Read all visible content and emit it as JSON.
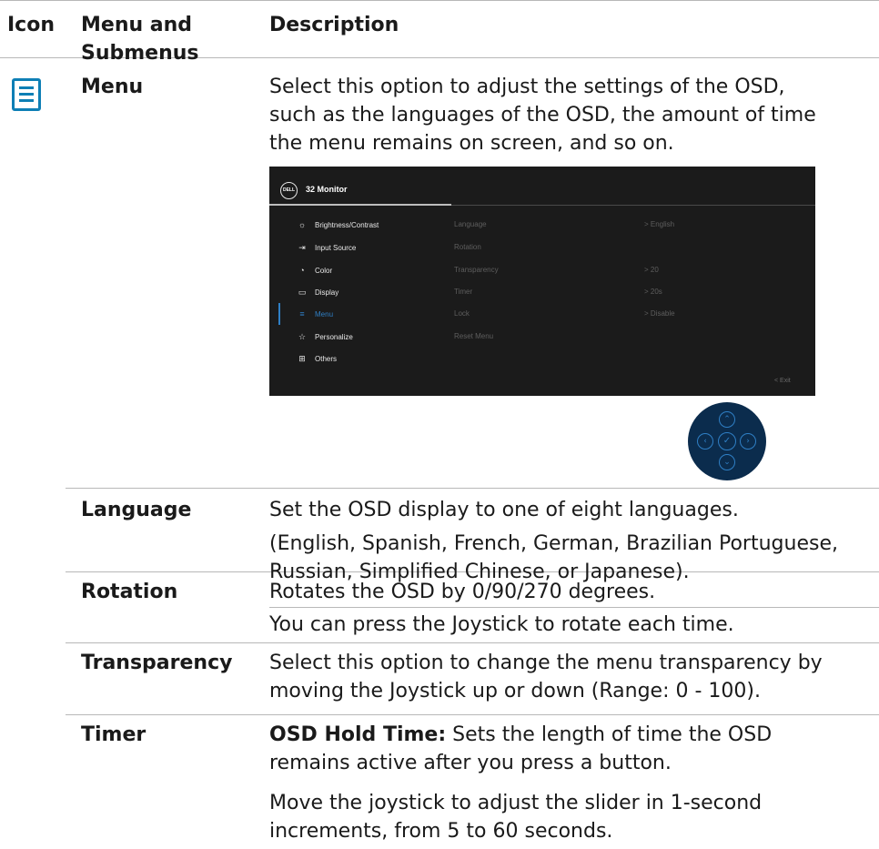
{
  "header": {
    "col_icon": "Icon",
    "col_menu": "Menu and Submenus",
    "col_desc": "Description"
  },
  "menu_row": {
    "name": "Menu",
    "icon": "menu-list-icon",
    "description": "Select this option to adjust the settings of the OSD, such as the languages of the OSD, the amount of time the menu remains on screen, and so on."
  },
  "osd": {
    "logo": "DELL",
    "title": "32 Monitor",
    "items": [
      {
        "label": "Brightness/Contrast",
        "icon": "sun-icon"
      },
      {
        "label": "Input Source",
        "icon": "input-icon"
      },
      {
        "label": "Color",
        "icon": "palette-icon"
      },
      {
        "label": "Display",
        "icon": "display-icon"
      },
      {
        "label": "Menu",
        "icon": "menu-icon"
      },
      {
        "label": "Personalize",
        "icon": "star-icon"
      },
      {
        "label": "Others",
        "icon": "others-icon"
      }
    ],
    "submenu": [
      {
        "label": "Language",
        "value": "> English"
      },
      {
        "label": "Rotation",
        "value": ""
      },
      {
        "label": "Transparency",
        "value": "> 20"
      },
      {
        "label": "Timer",
        "value": "> 20s"
      },
      {
        "label": "Lock",
        "value": "> Disable"
      },
      {
        "label": "Reset Menu",
        "value": ""
      }
    ],
    "exit": "< Exit",
    "accent": "#2f7fc5"
  },
  "rows": [
    {
      "name": "Language",
      "lines": [
        "Set the OSD display to one of eight languages.",
        "(English, Spanish, French, German, Brazilian Portuguese, Russian, Simplified Chinese, or Japanese)."
      ]
    },
    {
      "name": "Rotation",
      "lines": [
        "Rotates the OSD by 0/90/270 degrees.",
        "You can press the Joystick to rotate each time."
      ]
    },
    {
      "name": "Transparency",
      "lines": [
        "Select this option to change the menu transparency by moving the Joystick up or down (Range: 0 - 100)."
      ]
    },
    {
      "name": "Timer",
      "bold_lead": "OSD Hold Time:",
      "lines": [
        " Sets the length of time the OSD remains active after you press a button.",
        "Move the joystick to adjust the slider in 1-second increments, from 5 to 60 seconds."
      ]
    }
  ]
}
